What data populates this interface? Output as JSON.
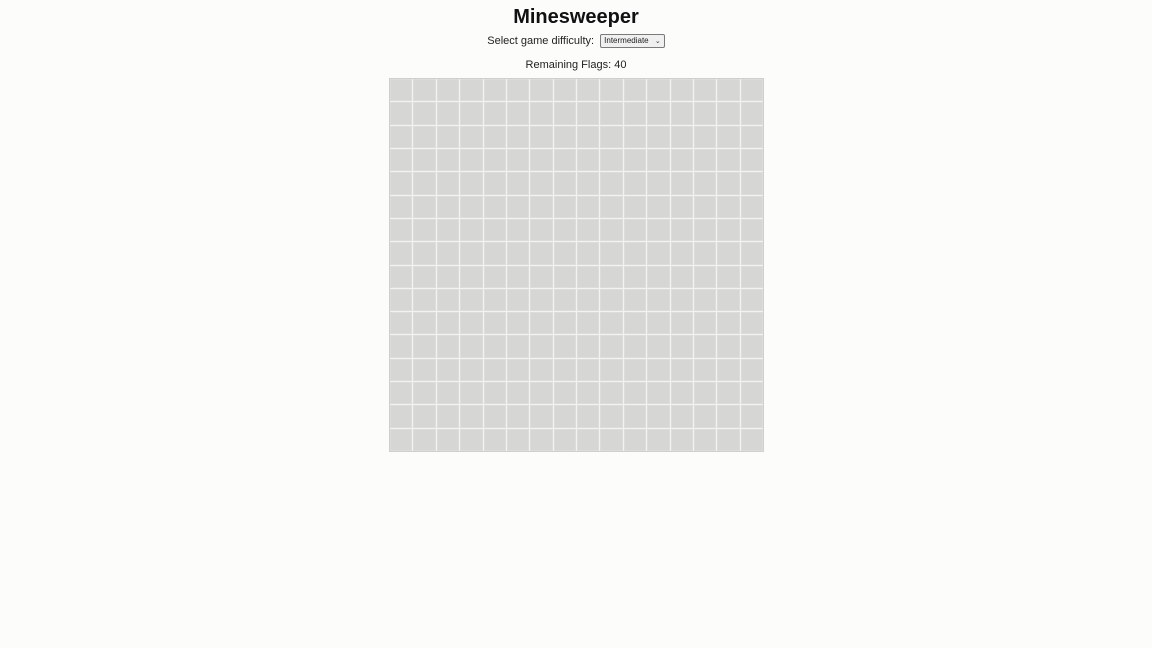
{
  "title": "Minesweeper",
  "difficulty": {
    "label": "Select game difficulty:",
    "selected": "Intermediate",
    "icon": "chevron-down-icon"
  },
  "flags": {
    "text": "Remaining Flags: 40"
  },
  "board": {
    "rows": 16,
    "cols": 16,
    "state": "all-covered"
  },
  "colors": {
    "background": "#fcfcfb",
    "cell": "#d6d6d4"
  }
}
